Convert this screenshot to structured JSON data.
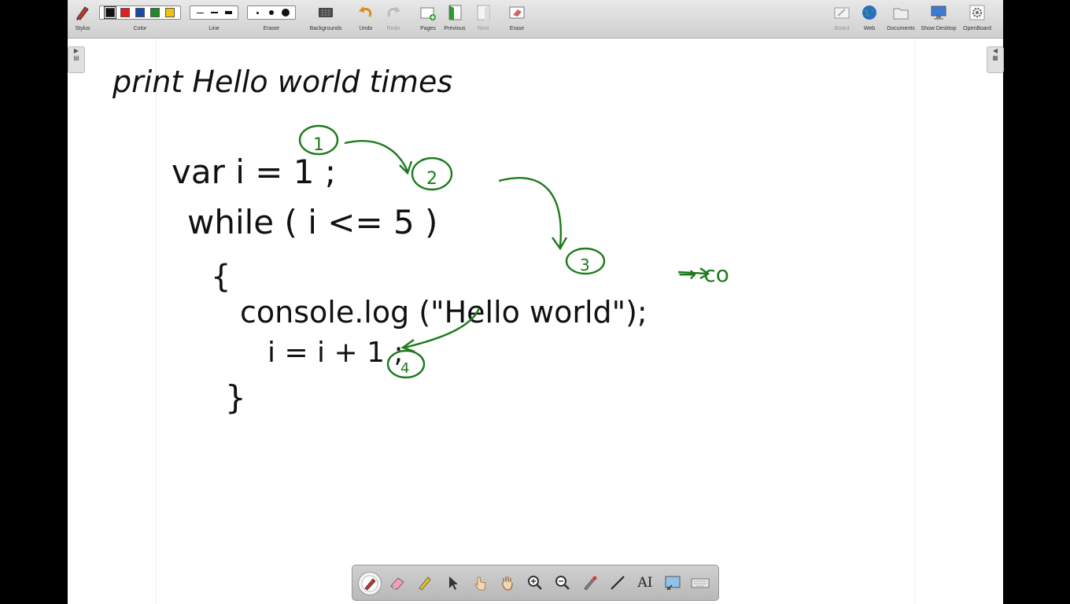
{
  "toolbar": {
    "stylus": "Stylus",
    "color": "Color",
    "line": "Line",
    "eraser": "Eraser",
    "backgrounds": "Backgrounds",
    "undo": "Undo",
    "redo": "Redo",
    "pages": "Pages",
    "previous": "Previous",
    "next": "Next",
    "erase": "Erase",
    "board": "Board",
    "web": "Web",
    "documents": "Documents",
    "show_desktop": "Show Desktop",
    "openboard": "OpenBoard"
  },
  "colors": {
    "swatches": [
      "#111111",
      "#e02020",
      "#1a4aa8",
      "#1f8a2a",
      "#f2c20a"
    ],
    "ink_black": "#111111",
    "ink_green": "#1e7a1e"
  },
  "board": {
    "title": "print Hello world times",
    "code": {
      "line1": "var i = 1 ;",
      "line2": "while ( i <= 5 )",
      "line3": "{",
      "line4": "console.log (\"Hello world\");",
      "line5": "i = i + 1 ;",
      "line6": "}"
    },
    "annotations": {
      "step1": "1",
      "step2": "2",
      "step3": "3",
      "step4": "4",
      "arrow_note": "→ co"
    }
  },
  "palette": {
    "tools": [
      "pen-icon",
      "eraser-icon",
      "marker-icon",
      "selector-icon",
      "interact-icon",
      "hand-icon",
      "zoom-in-icon",
      "zoom-out-icon",
      "laser-icon",
      "line-icon",
      "text-icon",
      "capture-icon",
      "keyboard-icon"
    ],
    "text_tool": "AI"
  }
}
